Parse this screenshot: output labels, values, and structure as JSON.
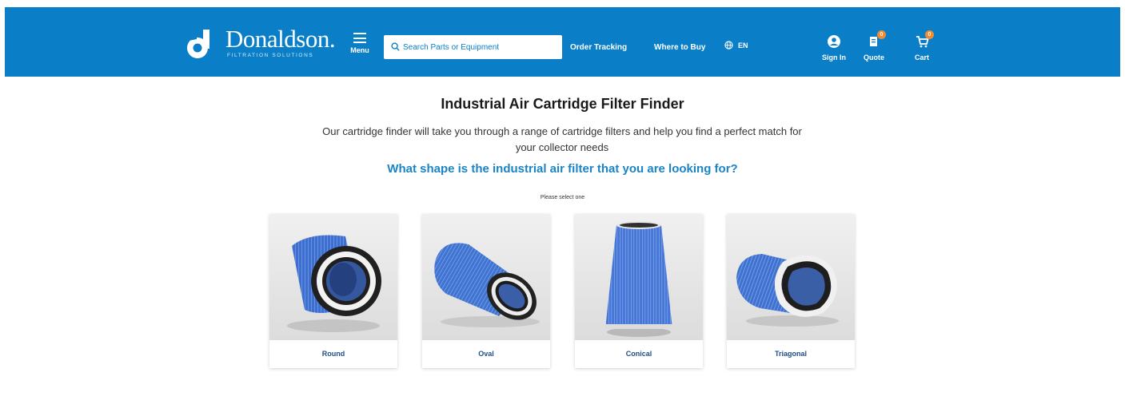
{
  "header": {
    "brand_name": "Donaldson.",
    "brand_tagline": "FILTRATION SOLUTIONS",
    "menu_label": "Menu",
    "search_placeholder": "Search Parts or Equipment",
    "order_tracking": "Order Tracking",
    "where_to_buy": "Where to Buy",
    "language": "EN",
    "sign_in": "Sign In",
    "quote": "Quote",
    "quote_count": "0",
    "cart": "Cart",
    "cart_count": "0",
    "bar_color": "#0a7fc8",
    "badge_color": "#f28b30"
  },
  "main": {
    "title": "Industrial Air Cartridge Filter Finder",
    "intro": "Our cartridge finder will take you through a range of cartridge filters and help you find a perfect match for your collector needs",
    "question": "What shape is the industrial air filter that you are looking for?",
    "hint": "Please select one",
    "options": [
      {
        "label": "Round"
      },
      {
        "label": "Oval"
      },
      {
        "label": "Conical"
      },
      {
        "label": "Triagonal"
      }
    ]
  }
}
